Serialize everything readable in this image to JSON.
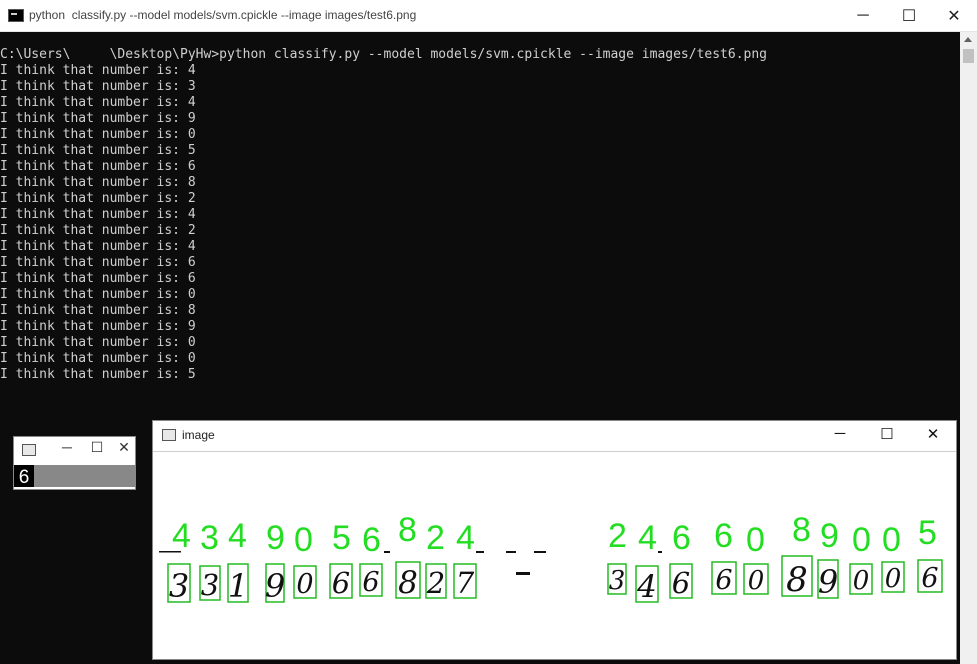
{
  "console": {
    "title": "python  classify.py --model models/svm.cpickle --image images/test6.png",
    "prompt_line": "C:\\Users\\     \\Desktop\\PyHw>python classify.py --model models/svm.cpickle --image images/test6.png",
    "output_prefix": "I think that number is: ",
    "predictions": [
      "4",
      "3",
      "4",
      "9",
      "0",
      "5",
      "6",
      "8",
      "2",
      "4",
      "2",
      "4",
      "6",
      "6",
      "0",
      "8",
      "9",
      "0",
      "0",
      "5"
    ],
    "controls": {
      "minimize": "─",
      "maximize": "☐",
      "close": "✕"
    }
  },
  "small_window": {
    "controls": {
      "minimize": "─",
      "maximize": "☐",
      "close": "✕"
    },
    "digit": "6"
  },
  "image_window": {
    "title": "image",
    "controls": {
      "minimize": "─",
      "maximize": "☐",
      "close": "✕"
    },
    "predicted_labels": [
      "4",
      "3",
      "4",
      "9",
      "0",
      "5",
      "6",
      "8",
      "2",
      "4",
      "2",
      "4",
      "6",
      "6",
      "0",
      "8",
      "9",
      "0",
      "0",
      "5"
    ],
    "handwritten_digits": [
      "3",
      "3",
      "1",
      "9",
      "0",
      "6",
      "6",
      "8",
      "2",
      "7",
      "3",
      "4",
      "6",
      "6",
      "0",
      "8",
      "9",
      "0",
      "0",
      "6"
    ],
    "label_color": "#22dd22",
    "box_color": "#22bb22",
    "digit_color": "#111111"
  }
}
